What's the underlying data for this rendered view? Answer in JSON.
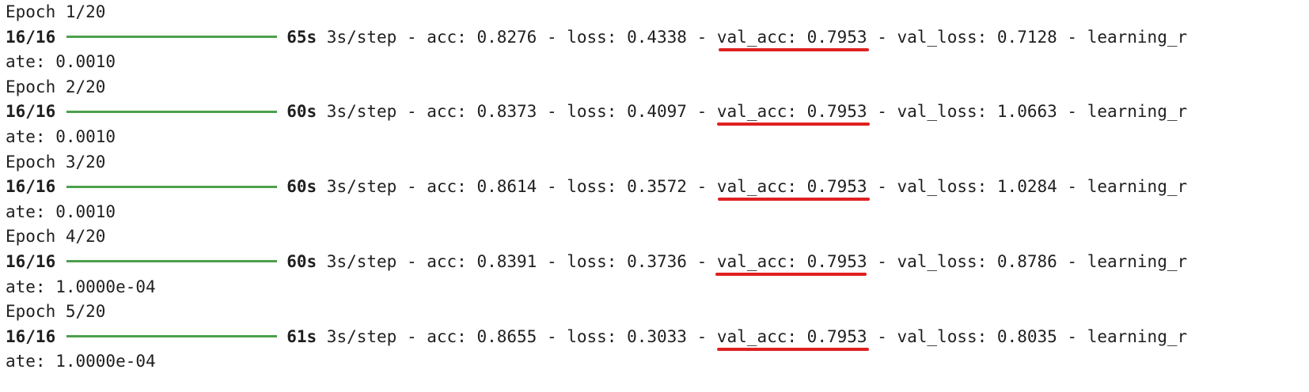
{
  "colors": {
    "progress_bar": "#4ca04c",
    "underline": "#e02020",
    "text": "#1f1f1f"
  },
  "epochs": [
    {
      "header": "Epoch 1/20",
      "steps": "16/16",
      "progress": 1.0,
      "time": "65s",
      "rest_pre": " 3s/step - acc: 0.8276 - loss: 0.4338 - ",
      "val_acc": "val_acc: 0.7953",
      "rest_post": " - val_loss: 0.7128 - learning_r",
      "wrap": "ate: 0.0010"
    },
    {
      "header": "Epoch 2/20",
      "steps": "16/16",
      "progress": 1.0,
      "time": "60s",
      "rest_pre": " 3s/step - acc: 0.8373 - loss: 0.4097 - ",
      "val_acc": "val_acc: 0.7953",
      "rest_post": " - val_loss: 1.0663 - learning_r",
      "wrap": "ate: 0.0010"
    },
    {
      "header": "Epoch 3/20",
      "steps": "16/16",
      "progress": 1.0,
      "time": "60s",
      "rest_pre": " 3s/step - acc: 0.8614 - loss: 0.3572 - ",
      "val_acc": "val_acc: 0.7953",
      "rest_post": " - val_loss: 1.0284 - learning_r",
      "wrap": "ate: 0.0010"
    },
    {
      "header": "Epoch 4/20",
      "steps": "16/16",
      "progress": 1.0,
      "time": "60s",
      "rest_pre": " 3s/step - acc: 0.8391 - loss: 0.3736 - ",
      "val_acc": "val_acc: 0.7953",
      "rest_post": " - val_loss: 0.8786 - learning_r",
      "wrap": "ate: 1.0000e-04"
    },
    {
      "header": "Epoch 5/20",
      "steps": "16/16",
      "progress": 1.0,
      "time": "61s",
      "rest_pre": " 3s/step - acc: 0.8655 - loss: 0.3033 - ",
      "val_acc": "val_acc: 0.7953",
      "rest_post": " - val_loss: 0.8035 - learning_r",
      "wrap": "ate: 1.0000e-04"
    }
  ]
}
